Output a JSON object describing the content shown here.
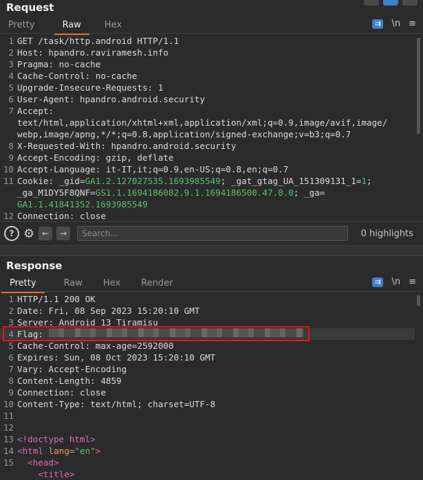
{
  "request": {
    "title": "Request",
    "tabs": [
      "Pretty",
      "Raw",
      "Hex"
    ],
    "active_tab": "Raw",
    "wrap_label": "\\n",
    "menu_label": "≡",
    "lines": [
      {
        "n": "1",
        "text": "GET /task/http.android HTTP/1.1"
      },
      {
        "n": "2",
        "text": "Host: hpandro.raviramesh.info"
      },
      {
        "n": "3",
        "text": "Pragma: no-cache"
      },
      {
        "n": "4",
        "text": "Cache-Control: no-cache"
      },
      {
        "n": "5",
        "text": "Upgrade-Insecure-Requests: 1"
      },
      {
        "n": "6",
        "text": "User-Agent: hpandro.android.security"
      },
      {
        "n": "7",
        "text": "Accept:"
      },
      {
        "n": "",
        "text": "text/html,application/xhtml+xml,application/xml;q=0.9,image/avif,image/"
      },
      {
        "n": "",
        "text": "webp,image/apng,*/*;q=0.8,application/signed-exchange;v=b3;q=0.7"
      },
      {
        "n": "8",
        "text": "X-Requested-With: hpandro.android.security"
      },
      {
        "n": "9",
        "text": "Accept-Encoding: gzip, deflate"
      },
      {
        "n": "10",
        "text": "Accept-Language: it-IT,it;q=0.9,en-US;q=0.8,en;q=0.7"
      }
    ],
    "cookie": {
      "n": "11",
      "prefix": "Cookie: _gid=",
      "v1": "GA1.2.127027535.1693985549",
      "mid1": "; _gat_gtag_UA_151309131_1=",
      "v2": "1",
      "end1": ";",
      "k2": "_ga_M1DY5F8QNF=",
      "v3": "GS1.1.1694186082.9.1.1694186500.47.0.0",
      "mid2": "; _ga=",
      "v4": "GA1.1.41841352.1693985549"
    },
    "last_line": {
      "n": "12",
      "text": "Connection: close"
    }
  },
  "search": {
    "help_label": "?",
    "placeholder": "Search...",
    "highlights": "0 highlights"
  },
  "response": {
    "title": "Response",
    "tabs": [
      "Pretty",
      "Raw",
      "Hex",
      "Render"
    ],
    "active_tab": "Pretty",
    "wrap_label": "\\n",
    "menu_label": "≡",
    "lines": [
      {
        "n": "1",
        "text": "HTTP/1.1 200 OK"
      },
      {
        "n": "2",
        "text": "Date: Fri, 08 Sep 2023 15:20:10 GMT"
      },
      {
        "n": "3",
        "text": "Server: Android 13 Tiramisu"
      }
    ],
    "flag_line": {
      "n": "4",
      "label": "Flag:"
    },
    "lines2": [
      {
        "n": "5",
        "text": "Cache-Control: max-age=2592000"
      },
      {
        "n": "6",
        "text": "Expires: Sun, 08 Oct 2023 15:20:10 GMT"
      },
      {
        "n": "7",
        "text": "Vary: Accept-Encoding"
      },
      {
        "n": "8",
        "text": "Content-Length: 4859"
      },
      {
        "n": "9",
        "text": "Connection: close"
      },
      {
        "n": "10",
        "text": "Content-Type: text/html; charset=UTF-8"
      },
      {
        "n": "11",
        "text": ""
      },
      {
        "n": "12",
        "text": ""
      }
    ],
    "html_lines": {
      "l13": {
        "n": "13",
        "text": "<!doctype html>"
      },
      "l14": {
        "n": "14",
        "open": "<html ",
        "attr": "lang=",
        "val": "\"en\"",
        "close": ">"
      },
      "l15": {
        "n": "15",
        "text": "  <head>"
      },
      "l16": {
        "n": "",
        "text": "    <title>"
      }
    }
  }
}
